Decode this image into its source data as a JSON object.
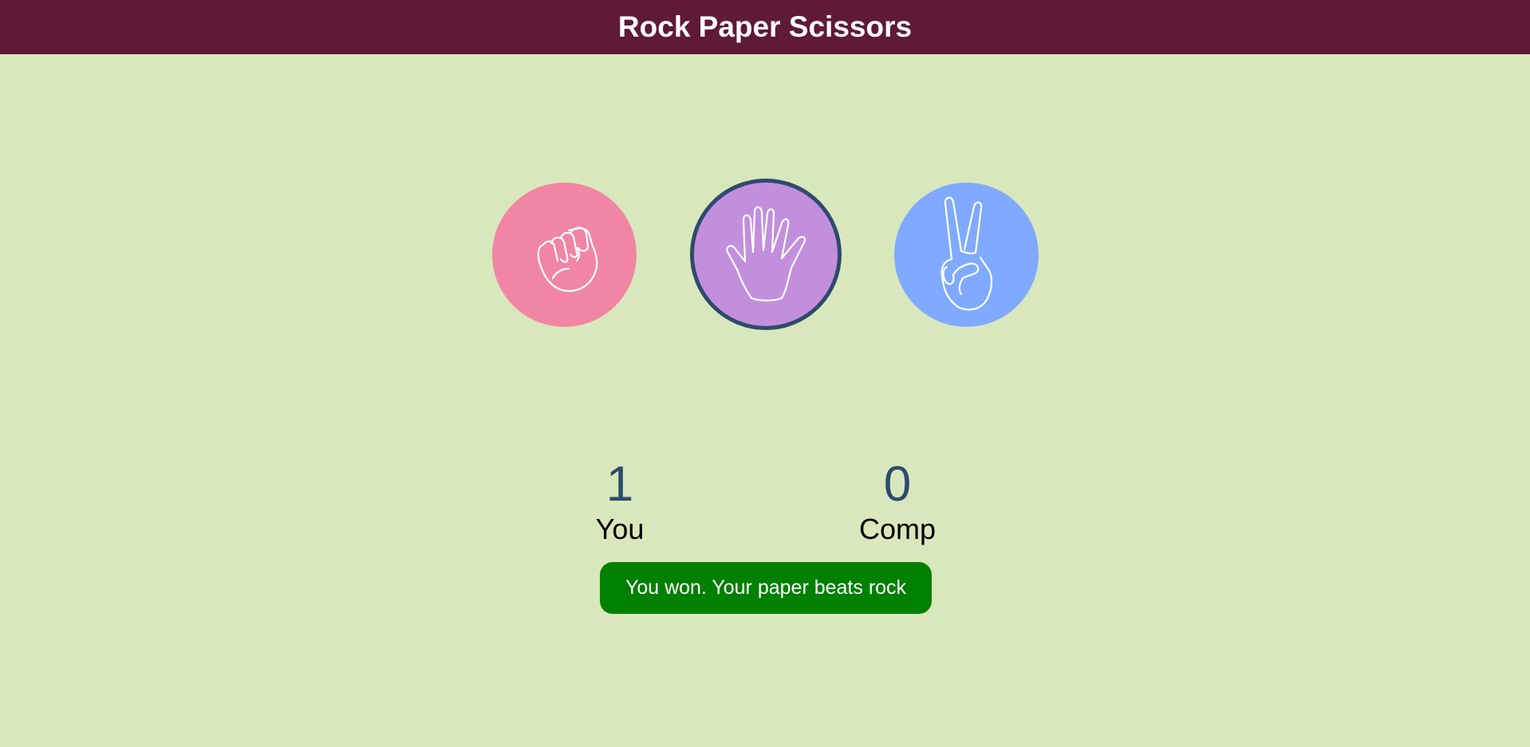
{
  "header": {
    "title": "Rock Paper Scissors"
  },
  "choices": [
    {
      "name": "rock",
      "color": "#f086a4",
      "selected": false,
      "icon": "fist-icon"
    },
    {
      "name": "paper",
      "color": "#c28fdd",
      "selected": true,
      "icon": "open-hand-icon"
    },
    {
      "name": "scissors",
      "color": "#80aaff",
      "selected": false,
      "icon": "peace-hand-icon"
    }
  ],
  "scoreboard": {
    "user": {
      "score": "1",
      "label": "You"
    },
    "computer": {
      "score": "0",
      "label": "Comp"
    }
  },
  "result": {
    "message": "You won. Your paper beats rock",
    "color": "#008000"
  },
  "colors": {
    "header_bg": "#5e1a37",
    "page_bg": "#d8e8bc",
    "score_number": "#2e4a6e",
    "selected_border": "#2e4a6e"
  }
}
